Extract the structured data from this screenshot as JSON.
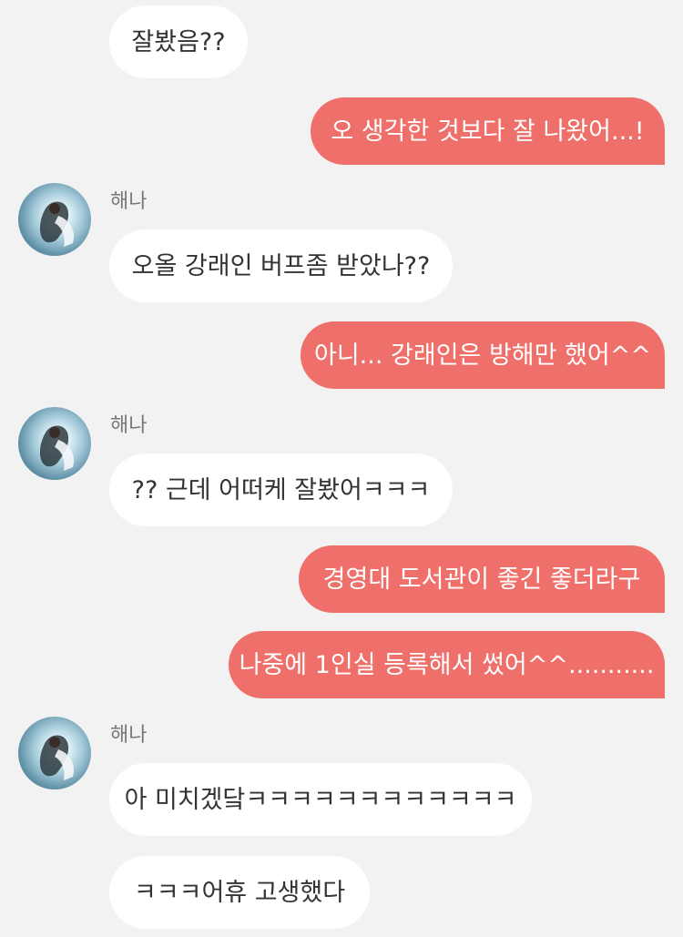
{
  "chat": {
    "contact_name": "해나",
    "messages": [
      {
        "from": "contact",
        "text": "잘봤음??"
      },
      {
        "from": "me",
        "text": "오 생각한 것보다 잘 나왔어...!"
      },
      {
        "from": "contact",
        "text": "오올 강래인 버프좀 받았나??"
      },
      {
        "from": "me",
        "text": "아니... 강래인은 방해만 했어^^"
      },
      {
        "from": "contact",
        "text": "?? 근데 어떠케 잘봤어ㅋㅋㅋ"
      },
      {
        "from": "me",
        "text": "경영대 도서관이 좋긴 좋더라구"
      },
      {
        "from": "me",
        "text": "나중에 1인실 등록해서 썼어^^..........."
      },
      {
        "from": "contact",
        "text": "아 미치겠닼ㅋㅋㅋㅋㅋㅋㅋㅋㅋㅋㅋㅋ"
      },
      {
        "from": "contact",
        "text": "ㅋㅋㅋ어휴 고생했다"
      }
    ]
  },
  "colors": {
    "background": "#f2f2f2",
    "incoming_bubble": "#ffffff",
    "outgoing_bubble": "#ef706a",
    "incoming_text": "#333333",
    "outgoing_text": "#ffffff",
    "sender_name": "#777777"
  }
}
